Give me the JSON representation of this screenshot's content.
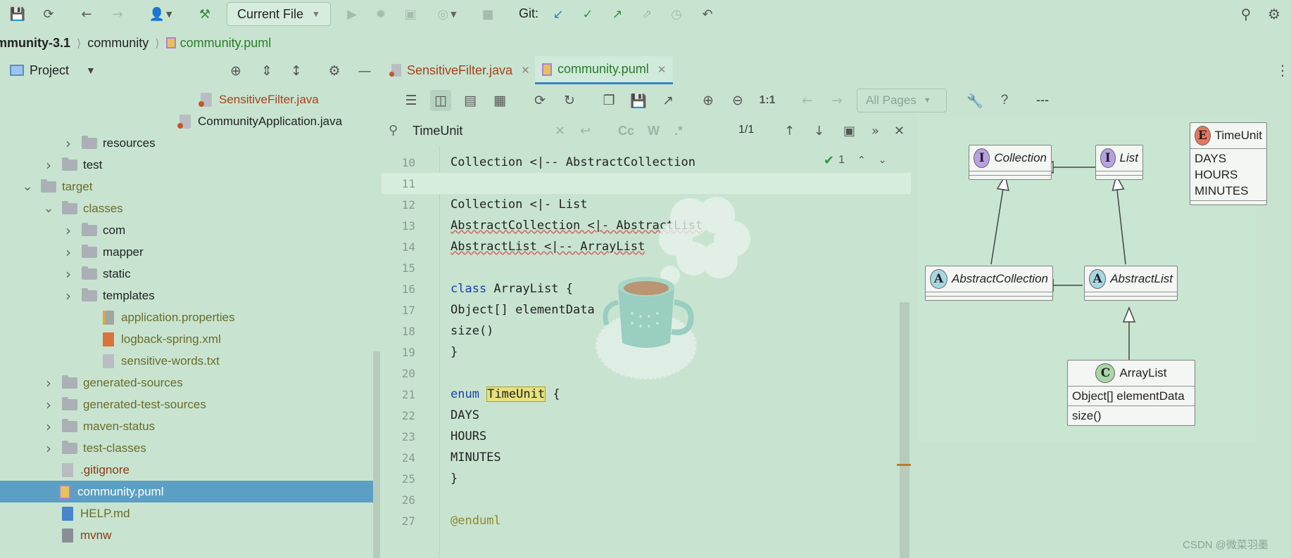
{
  "toolbar": {
    "buttons": [
      "save-icon",
      "sync-icon",
      "back-icon",
      "forward-icon",
      "user-icon",
      "build-hammer-icon"
    ],
    "run_config": "Current File",
    "git_label": "Git:"
  },
  "breadcrumb": {
    "project": "mmunity-3.1",
    "module": "community",
    "file": "community.puml"
  },
  "project_panel": {
    "title": "Project",
    "tree": [
      {
        "label": "SensitiveFilter.java",
        "kind": "java",
        "style": "red"
      },
      {
        "label": "CommunityApplication.java",
        "kind": "java",
        "style": "dark"
      },
      {
        "label": "resources",
        "kind": "folder",
        "expanded": false
      },
      {
        "label": "test",
        "kind": "folder",
        "expanded": false
      },
      {
        "label": "target",
        "kind": "folder",
        "expanded": true
      },
      {
        "label": "classes",
        "kind": "folder",
        "expanded": true
      },
      {
        "label": "com",
        "kind": "folder",
        "expanded": false
      },
      {
        "label": "mapper",
        "kind": "folder",
        "expanded": false
      },
      {
        "label": "static",
        "kind": "folder",
        "expanded": false
      },
      {
        "label": "templates",
        "kind": "folder",
        "expanded": false
      },
      {
        "label": "application.properties",
        "kind": "props"
      },
      {
        "label": "logback-spring.xml",
        "kind": "xml"
      },
      {
        "label": "sensitive-words.txt",
        "kind": "txt"
      },
      {
        "label": "generated-sources",
        "kind": "folder",
        "expanded": false
      },
      {
        "label": "generated-test-sources",
        "kind": "folder",
        "expanded": false
      },
      {
        "label": "maven-status",
        "kind": "folder",
        "expanded": false
      },
      {
        "label": "test-classes",
        "kind": "folder",
        "expanded": false
      },
      {
        "label": ".gitignore",
        "kind": "file",
        "style": "brown"
      },
      {
        "label": "community.puml",
        "kind": "puml",
        "selected": true
      },
      {
        "label": "HELP.md",
        "kind": "md"
      },
      {
        "label": "mvnw",
        "kind": "mvnw",
        "style": "brown"
      }
    ]
  },
  "tabs": [
    {
      "label": "SensitiveFilter.java",
      "active": false
    },
    {
      "label": "community.puml",
      "active": true
    }
  ],
  "preview_toolbar": {
    "zoom_label": "1:1",
    "pages_select": "All Pages",
    "help_label": "?",
    "extra_label": "---"
  },
  "search": {
    "value": "TimeUnit",
    "case_label": "Cc",
    "word_label": "W",
    "regex_label": ".*",
    "match_count": "1/1"
  },
  "editor": {
    "inspection_count": "1",
    "lines": [
      {
        "n": "10",
        "text": "Collection <|-- AbstractCollection"
      },
      {
        "n": "11",
        "text": ""
      },
      {
        "n": "12",
        "text": "Collection <|- List"
      },
      {
        "n": "13",
        "text": "AbstractCollection <|- AbstractList"
      },
      {
        "n": "14",
        "text": "AbstractList <|-- ArrayList"
      },
      {
        "n": "15",
        "text": ""
      },
      {
        "n": "16",
        "kw": "class",
        "text": " ArrayList {"
      },
      {
        "n": "17",
        "text": "Object[] elementData"
      },
      {
        "n": "18",
        "text": "size()"
      },
      {
        "n": "19",
        "text": "}"
      },
      {
        "n": "20",
        "text": ""
      },
      {
        "n": "21",
        "kw": "enum",
        "hl": "TimeUnit",
        "text": " {"
      },
      {
        "n": "22",
        "text": "DAYS"
      },
      {
        "n": "23",
        "text": "HOURS"
      },
      {
        "n": "24",
        "text": "MINUTES"
      },
      {
        "n": "25",
        "text": "}"
      },
      {
        "n": "26",
        "text": ""
      },
      {
        "n": "27",
        "anno": "@enduml"
      }
    ]
  },
  "diagram": {
    "collection": {
      "badge": "I",
      "name": "Collection"
    },
    "list": {
      "badge": "I",
      "name": "List"
    },
    "abstract_collection": {
      "badge": "A",
      "name": "AbstractCollection"
    },
    "abstract_list": {
      "badge": "A",
      "name": "AbstractList"
    },
    "array_list": {
      "badge": "C",
      "name": "ArrayList",
      "field": "Object[] elementData",
      "method": "size()"
    },
    "time_unit": {
      "badge": "E",
      "name": "TimeUnit",
      "values": [
        "DAYS",
        "HOURS",
        "MINUTES"
      ]
    },
    "colors": {
      "interface": "#b7a1e0",
      "abstract": "#a7d7e0",
      "class": "#a8d6a8",
      "enum": "#e8765e"
    }
  },
  "watermark": "CSDN @微菜羽墨"
}
